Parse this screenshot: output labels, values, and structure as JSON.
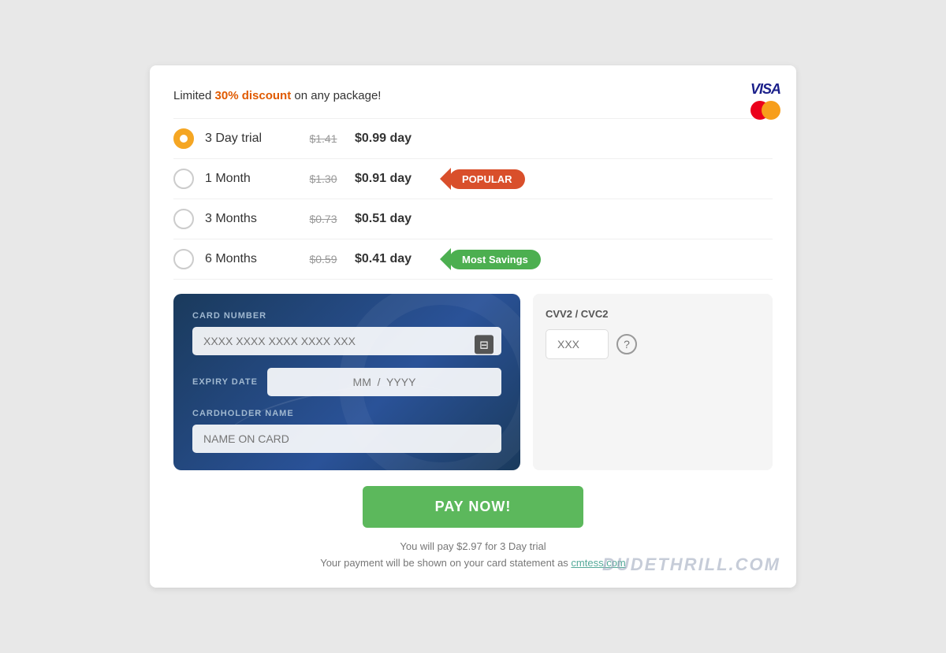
{
  "header": {
    "discount_text": "Limited ",
    "discount_highlight": "30% discount",
    "discount_suffix": " on any package!"
  },
  "plans": [
    {
      "id": "3day",
      "name": "3 Day trial",
      "old_price": "$1.41",
      "new_price": "$0.99 day",
      "badge": null,
      "selected": true
    },
    {
      "id": "1month",
      "name": "1 Month",
      "old_price": "$1.30",
      "new_price": "$0.91 day",
      "badge": "POPULAR",
      "badge_type": "popular",
      "selected": false
    },
    {
      "id": "3months",
      "name": "3 Months",
      "old_price": "$0.73",
      "new_price": "$0.51 day",
      "badge": null,
      "selected": false
    },
    {
      "id": "6months",
      "name": "6 Months",
      "old_price": "$0.59",
      "new_price": "$0.41 day",
      "badge": "Most Savings",
      "badge_type": "savings",
      "selected": false
    }
  ],
  "card_form": {
    "card_number_label": "CARD NUMBER",
    "card_number_placeholder": "XXXX XXXX XXXX XXXX XXX",
    "expiry_label": "EXPIRY DATE",
    "expiry_placeholder": "MM  /  YYYY",
    "cardholder_label": "CARDHOLDER NAME",
    "cardholder_placeholder": "NAME ON CARD",
    "cvv_label": "CVV2 / CVC2",
    "cvv_placeholder": "XXX"
  },
  "pay_button": {
    "label": "PAY NOW!"
  },
  "footer": {
    "line1": "You will pay $2.97 for 3 Day trial",
    "line2_prefix": "Your payment will be shown on your card statement as ",
    "line2_link": "cmtess.com"
  },
  "watermark": "DUDETHRILL.COM"
}
